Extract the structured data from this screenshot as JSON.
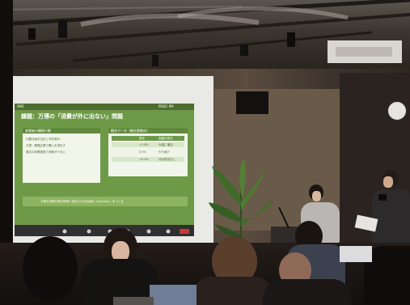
{
  "slide": {
    "header_left": "SMS",
    "header_right": "PDDC IPA",
    "title": "課題：万博の「消費が外に出ない」問題",
    "left_box": {
      "heading": "来場者の購買行動",
      "bullets": [
        "行動計画を当日に予約済み",
        "万博・関連企業で購入を済ます",
        "周辺の商業施設で消費が少ない"
      ]
    },
    "right_box": {
      "heading": "観光データ（観光客動向）",
      "columns": [
        "",
        "割合",
        "金額の変化"
      ],
      "rows": [
        [
          "",
          "+1.8%",
          "大幅に増加"
        ],
        [
          "",
          "0.9%",
          "やや減少"
        ],
        [
          "",
          "+0.4%",
          "ほぼ変化なし"
        ]
      ]
    },
    "banner": "万博の消費を周辺地域へ波及させる仕組み「mapion2」をつくる"
  },
  "colors": {
    "slide_bg": "#6e9a48",
    "slide_header": "#4d6d30",
    "ceiling": "#35302b",
    "wall": "#4a3d31",
    "audience": "#181412"
  }
}
